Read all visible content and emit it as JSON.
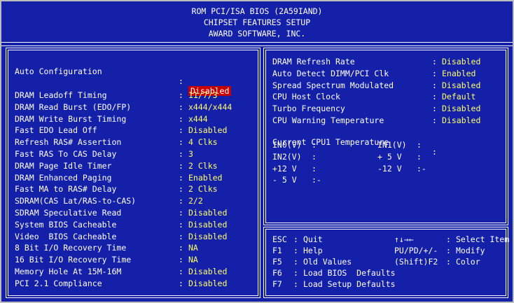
{
  "header": {
    "line1": "ROM PCI/ISA BIOS (2A59IAND)",
    "line2": "CHIPSET FEATURES SETUP",
    "line3": "AWARD SOFTWARE, INC."
  },
  "left": {
    "auto_config": {
      "label": "Auto Configuration",
      "value": "Disabled"
    },
    "items": [
      {
        "label": "DRAM Leadoff Timing",
        "value": "11/7/3"
      },
      {
        "label": "DRAM Read Burst (EDO/FP)",
        "value": "x444/x444"
      },
      {
        "label": "DRAM Write Burst Timing",
        "value": "x444"
      },
      {
        "label": "Fast EDO Lead Off",
        "value": "Disabled"
      },
      {
        "label": "Refresh RAS# Assertion",
        "value": "4 Clks"
      },
      {
        "label": "Fast RAS To CAS Delay",
        "value": "3"
      },
      {
        "label": "DRAM Page Idle Timer",
        "value": "2 Clks"
      },
      {
        "label": "DRAM Enhanced Paging",
        "value": "Enabled"
      },
      {
        "label": "Fast MA to RAS# Delay",
        "value": "2 Clks"
      },
      {
        "label": "SDRAM(CAS Lat/RAS-to-CAS)",
        "value": "2/2"
      },
      {
        "label": "SDRAM Speculative Read",
        "value": "Disabled"
      },
      {
        "label": "System BIOS Cacheable",
        "value": "Disabled"
      },
      {
        "label": "Video  BIOS Cacheable",
        "value": "Disabled"
      },
      {
        "label": "8 Bit I/O Recovery Time",
        "value": "NA"
      },
      {
        "label": "16 Bit I/O Recovery Time",
        "value": "NA"
      },
      {
        "label": "Memory Hole At 15M-16M",
        "value": "Disabled"
      },
      {
        "label": "PCI 2.1 Compliance",
        "value": "Disabled"
      }
    ]
  },
  "right": {
    "items": [
      {
        "label": "DRAM Refresh Rate",
        "value": "Disabled"
      },
      {
        "label": "Auto Detect DIMM/PCI Clk",
        "value": "Enabled"
      },
      {
        "label": "Spread Spectrum Modulated",
        "value": "Disabled"
      },
      {
        "label": "CPU Host Clock",
        "value": "Default"
      },
      {
        "label": "Turbo Frequency",
        "value": "Disabled"
      },
      {
        "label": "CPU Warning Temperature",
        "value": "Disabled"
      }
    ],
    "current_temp_label": "Current CPU1 Temperature",
    "voltages": [
      {
        "label": "IN0(V)",
        "sep": ":",
        "label2": "IN1(V)",
        "sep2": ":"
      },
      {
        "label": "IN2(V)",
        "sep": ":",
        "label2": "+ 5 V",
        "sep2": ":"
      },
      {
        "label": "+12 V",
        "sep": ":",
        "label2": "-12 V",
        "sep2": ":-"
      },
      {
        "label": "- 5 V",
        "sep": ":-",
        "label2": "",
        "sep2": ""
      }
    ]
  },
  "help": {
    "rows": [
      {
        "key": "ESC",
        "desc": "Quit",
        "key2": "↑↓→←",
        "desc2": "Select Item"
      },
      {
        "key": "F1",
        "desc": "Help",
        "key2": "PU/PD/+/-",
        "desc2": "Modify"
      },
      {
        "key": "F5",
        "desc": "Old Values",
        "key2": "(Shift)F2",
        "desc2": "Color"
      },
      {
        "key": "F6",
        "desc": "Load BIOS  Defaults",
        "key2": "",
        "desc2": ""
      },
      {
        "key": "F7",
        "desc": "Load Setup Defaults",
        "key2": "",
        "desc2": ""
      }
    ]
  },
  "colors": {
    "background": "#1420a8",
    "label": "#ffffff",
    "value": "#ffff66",
    "highlight": "#c80000"
  }
}
